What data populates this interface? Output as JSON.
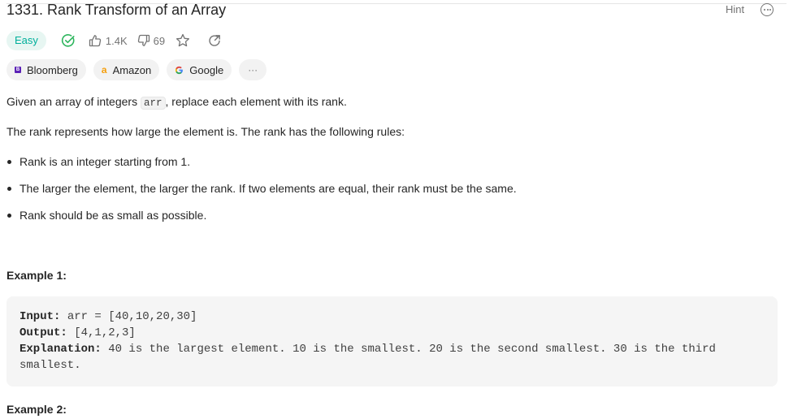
{
  "problem": {
    "title": "1331. Rank Transform of an Array",
    "hint_label": "Hint",
    "difficulty": "Easy",
    "likes": "1.4K",
    "dislikes": "69",
    "colors": {
      "easy_text": "#00af9b",
      "easy_bg": "#e7f6f2",
      "solved": "#2db55d"
    }
  },
  "tags": [
    {
      "label": "Bloomberg",
      "icon": "bloomberg-logo"
    },
    {
      "label": "Amazon",
      "icon": "amazon-logo"
    },
    {
      "label": "Google",
      "icon": "google-logo"
    }
  ],
  "tags_more": "···",
  "description": {
    "intro_before": "Given an array of integers ",
    "intro_code": "arr",
    "intro_after": ", replace each element with its rank.",
    "rules_intro": "The rank represents how large the element is. The rank has the following rules:",
    "rules": [
      "Rank is an integer starting from 1.",
      "The larger the element, the larger the rank. If two elements are equal, their rank must be the same.",
      "Rank should be as small as possible."
    ]
  },
  "examples": [
    {
      "heading": "Example 1:",
      "input_label": "Input:",
      "input": " arr = [40,10,20,30]",
      "output_label": "Output:",
      "output": " [4,1,2,3]",
      "explanation_label": "Explanation:",
      "explanation": " 40 is the largest element. 10 is the smallest. 20 is the second smallest. 30 is the third smallest."
    },
    {
      "heading": "Example 2:"
    }
  ]
}
